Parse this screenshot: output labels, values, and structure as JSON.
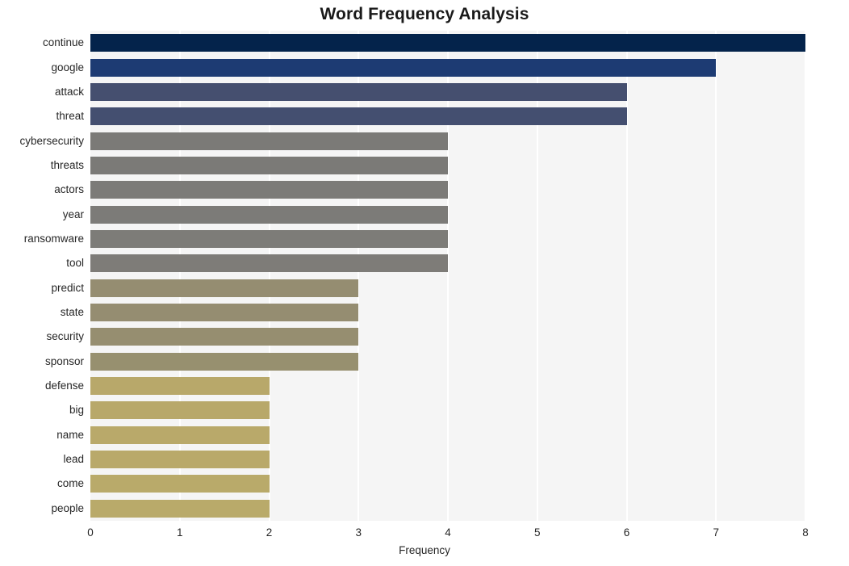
{
  "chart_data": {
    "type": "bar",
    "orientation": "horizontal",
    "title": "Word Frequency Analysis",
    "xlabel": "Frequency",
    "ylabel": "",
    "xlim": [
      0,
      8
    ],
    "xticks": [
      "0",
      "1",
      "2",
      "3",
      "4",
      "5",
      "6",
      "7",
      "8"
    ],
    "grid": true,
    "grid_axis": "x",
    "legend": null,
    "categories": [
      "continue",
      "google",
      "attack",
      "threat",
      "cybersecurity",
      "threats",
      "actors",
      "year",
      "ransomware",
      "tool",
      "predict",
      "state",
      "security",
      "sponsor",
      "defense",
      "big",
      "name",
      "lead",
      "come",
      "people"
    ],
    "values": [
      8,
      7,
      6,
      6,
      4,
      4,
      4,
      4,
      4,
      4,
      3,
      3,
      3,
      3,
      2,
      2,
      2,
      2,
      2,
      2
    ],
    "bar_colors": [
      "#04234b",
      "#1d3b73",
      "#454f6f",
      "#444f70",
      "#7b7a77",
      "#7b7a77",
      "#7c7b78",
      "#7c7b78",
      "#7d7c78",
      "#7e7c78",
      "#958d71",
      "#958d71",
      "#968e70",
      "#97906f",
      "#b8a86a",
      "#b8a86a",
      "#b9a96a",
      "#b9a96a",
      "#b9aa6a",
      "#b9aa6a"
    ],
    "plot_background": "#f5f5f5",
    "figure_background": "#ffffff",
    "gridline_color": "#ffffff"
  }
}
